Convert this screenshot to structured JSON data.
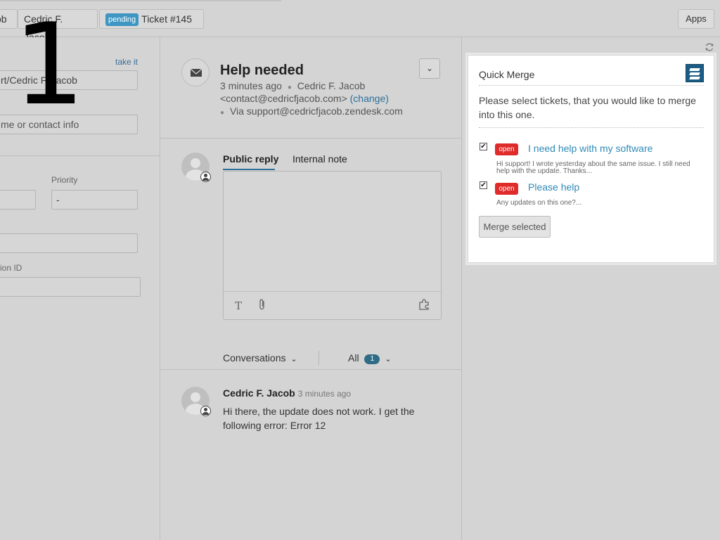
{
  "header": {
    "requester_tab_partial": "ob",
    "user_tab": "Cedric F. Jacob",
    "ticket_tab": {
      "status_badge": "pending",
      "label": "Ticket #145"
    },
    "apps_button": "Apps"
  },
  "step_number": "1",
  "left_panel": {
    "take_it_link": "take it",
    "requester_value": "rt/Cedric F. Jacob",
    "ccs_placeholder": "me or contact info",
    "priority_label": "Priority",
    "priority_value": "-",
    "id_label": "ion ID"
  },
  "ticket": {
    "subject": "Help needed",
    "time": "3 minutes ago",
    "author": "Cedric F. Jacob",
    "email": "<contact@cedricfjacob.com>",
    "change_link": "(change)",
    "via": "Via support@cedricfjacob.zendesk.com"
  },
  "reply": {
    "tabs": [
      "Public reply",
      "Internal note"
    ]
  },
  "conversation_filter": {
    "conversations_label": "Conversations",
    "all_label": "All",
    "all_count": "1"
  },
  "comment": {
    "author": "Cedric F. Jacob",
    "time": "3 minutes ago",
    "text": "Hi there, the update does not work. I get the following error: Error 12"
  },
  "quick_merge": {
    "title": "Quick Merge",
    "description": "Please select tickets, that you would like to merge into this one.",
    "tickets": [
      {
        "status": "open",
        "title": "I need help with my software",
        "snippet": "Hi support! I wrote yesterday about the same issue. I still need help with the update. Thanks...",
        "checked": true
      },
      {
        "status": "open",
        "title": "Please help",
        "snippet": "Any updates on this one?...",
        "checked": true
      }
    ],
    "merge_button": "Merge selected"
  }
}
